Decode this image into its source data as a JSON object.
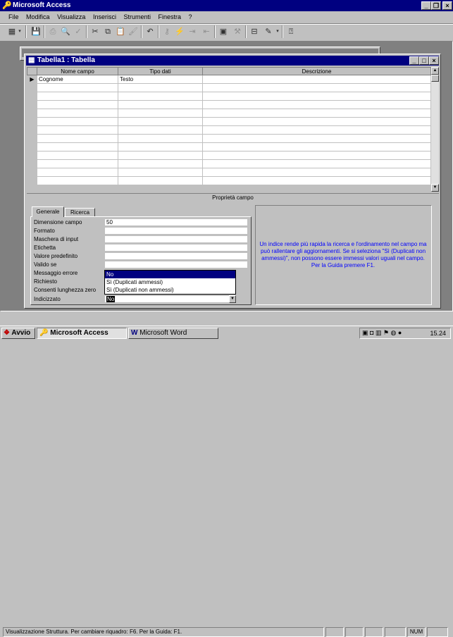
{
  "app": {
    "title": "Microsoft Access"
  },
  "menu": [
    "File",
    "Modifica",
    "Visualizza",
    "Inserisci",
    "Strumenti",
    "Finestra",
    "?"
  ],
  "toolbar_icons": [
    "view-icon",
    "save-icon",
    "print-icon",
    "print-preview-icon",
    "spelling-icon",
    "cut-icon",
    "copy-icon",
    "paste-icon",
    "format-painter-icon",
    "undo-icon",
    "key-icon",
    "builder-icon",
    "insert-rows-icon",
    "delete-rows-icon",
    "properties-icon",
    "build-icon",
    "database-window-icon",
    "new-object-icon",
    "help-icon"
  ],
  "table_window": {
    "title": "Tabella1 : Tabella",
    "columns": [
      "Nome campo",
      "Tipo dati",
      "Descrizione"
    ],
    "rows": [
      {
        "name": "Cognome",
        "type": "Testo",
        "desc": ""
      }
    ]
  },
  "field_properties": {
    "title": "Proprietà campo",
    "tabs": [
      "Generale",
      "Ricerca"
    ],
    "active_tab": "Generale",
    "props": [
      {
        "label": "Dimensione campo",
        "value": "50"
      },
      {
        "label": "Formato",
        "value": ""
      },
      {
        "label": "Maschera di input",
        "value": ""
      },
      {
        "label": "Etichetta",
        "value": ""
      },
      {
        "label": "Valore predefinito",
        "value": ""
      },
      {
        "label": "Valido se",
        "value": ""
      },
      {
        "label": "Messaggio errore",
        "value": ""
      },
      {
        "label": "Richiesto",
        "value": ""
      },
      {
        "label": "Consenti lunghezza zero",
        "value": ""
      },
      {
        "label": "Indicizzato",
        "value": "No"
      }
    ],
    "dropdown_options": [
      "No",
      "Sì (Duplicati ammessi)",
      "Sì (Duplicati non ammessi)"
    ],
    "help_text": "Un indice rende più rapida la ricerca e l'ordinamento nel campo ma può rallentare gli aggiornamenti. Se si seleziona \"Sì (Duplicati non ammessi)\", non possono essere immessi valori uguali nel campo. Per la Guida premere F1."
  },
  "status": {
    "text": "Visualizzazione Struttura. Per cambiare riquadro: F6. Per la Guida: F1.",
    "num": "NUM"
  },
  "taskbar": {
    "start": "Avvio",
    "buttons": [
      "Microsoft Access",
      "Microsoft Word"
    ],
    "clock": "15.24"
  },
  "colors": {
    "titlebar": "#000080",
    "desktop": "#808080",
    "help_text": "#0000ff"
  }
}
